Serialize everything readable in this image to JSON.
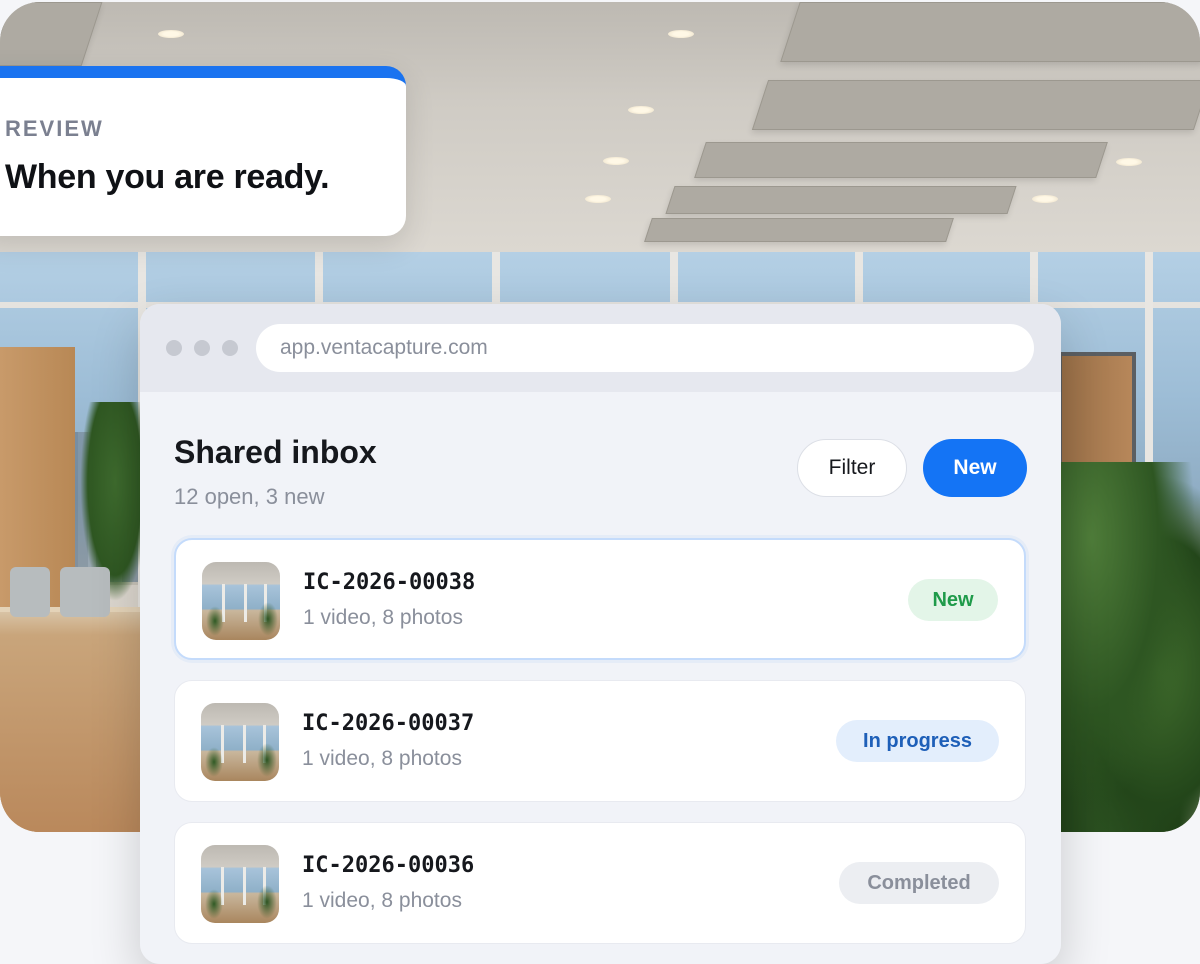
{
  "review_card": {
    "eyebrow": "REVIEW",
    "title": "When you are ready.",
    "accent_color": "#1a73f0"
  },
  "browser": {
    "url": "app.ventacapture.com"
  },
  "inbox": {
    "title": "Shared inbox",
    "subtitle": "12 open, 3 new",
    "filter_label": "Filter",
    "new_label": "New",
    "items": [
      {
        "id": "IC-2026-00038",
        "meta": "1 video, 8 photos",
        "status": "New",
        "status_color": "#1f9b4a"
      },
      {
        "id": "IC-2026-00037",
        "meta": "1 video, 8 photos",
        "status": "In progress",
        "status_color": "#1e5fb8"
      },
      {
        "id": "IC-2026-00036",
        "meta": "1 video, 8 photos",
        "status": "Completed",
        "status_color": "#8a8f9b"
      }
    ]
  },
  "colors": {
    "primary": "#1474f5",
    "text": "#16181d",
    "muted": "#8a8f9b"
  }
}
